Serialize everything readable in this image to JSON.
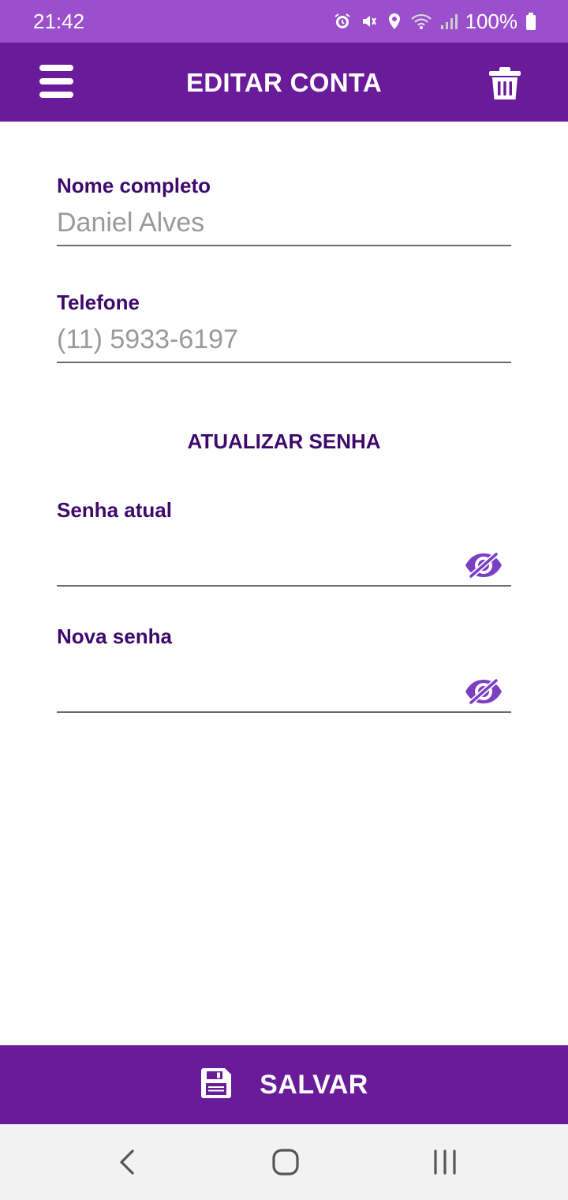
{
  "status_bar": {
    "time": "21:42",
    "battery": "100%",
    "icons": [
      "alarm-icon",
      "mute-vibrate-icon",
      "location-icon",
      "wifi-icon",
      "signal-icon",
      "battery-icon"
    ]
  },
  "app_bar": {
    "title": "EDITAR CONTA",
    "menu_icon": "hamburger-menu-icon",
    "delete_icon": "trash-icon"
  },
  "form": {
    "name": {
      "label": "Nome completo",
      "placeholder": "Daniel Alves"
    },
    "phone": {
      "label": "Telefone",
      "placeholder": "(11) 5933-6197"
    },
    "password_section_title": "ATUALIZAR SENHA",
    "current_password": {
      "label": "Senha atual",
      "value": "",
      "toggle_icon": "eye-off-icon"
    },
    "new_password": {
      "label": "Nova senha",
      "value": "",
      "toggle_icon": "eye-off-icon"
    }
  },
  "save_button": {
    "label": "SALVAR",
    "icon": "floppy-disk-icon"
  },
  "nav_bar": {
    "buttons": [
      "back-icon",
      "home-icon",
      "recents-icon"
    ]
  },
  "colors": {
    "status_bar": "#9b4fcc",
    "app_bar": "#6a1b9a",
    "label_text": "#3d0a6b",
    "eye_icon": "#7b3fc4",
    "input_text": "#9a9a9a",
    "nav_bar": "#f2f2f2"
  }
}
